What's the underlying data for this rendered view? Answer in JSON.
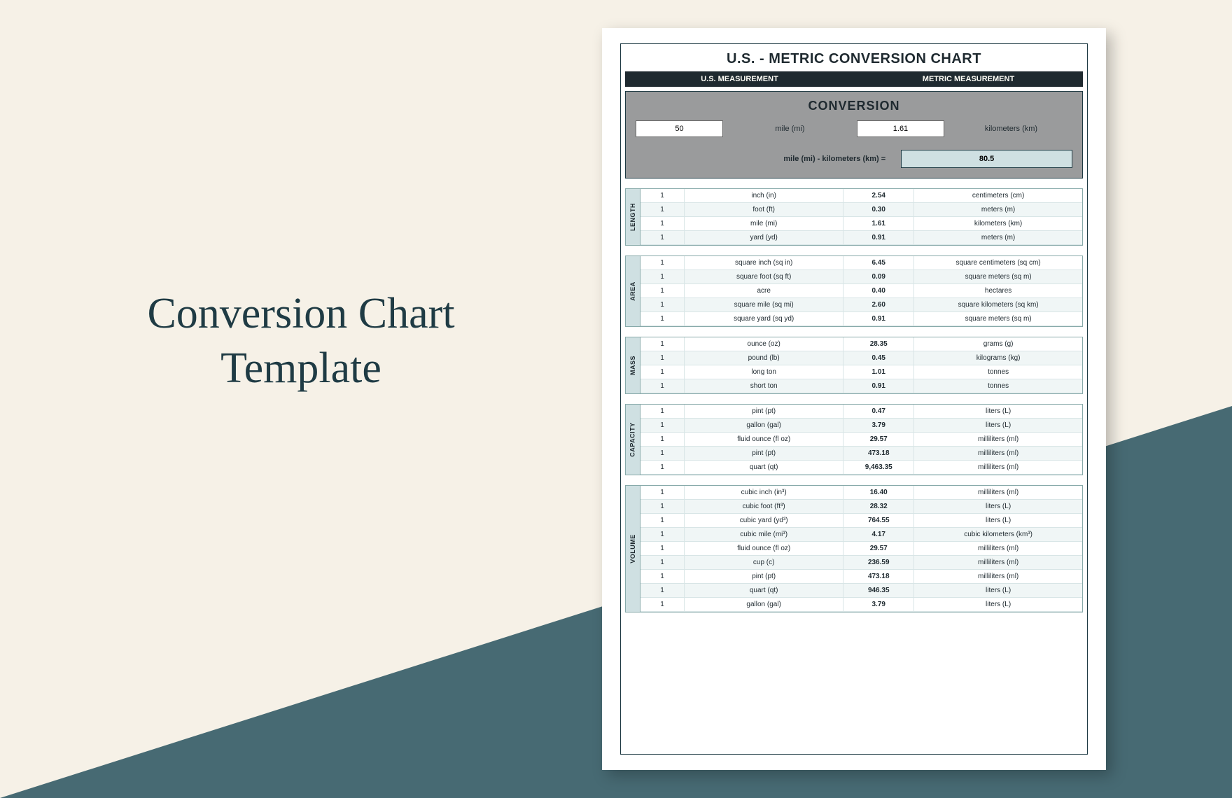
{
  "side_title": "Conversion Chart Template",
  "doc": {
    "title": "U.S. - METRIC CONVERSION CHART",
    "header_left": "U.S. MEASUREMENT",
    "header_right": "METRIC MEASUREMENT",
    "conversion": {
      "title": "CONVERSION",
      "input_value": "50",
      "input_unit": "mile (mi)",
      "factor": "1.61",
      "output_unit": "kilometers (km)",
      "result_label": "mile (mi) - kilometers (km) =",
      "result_value": "80.5"
    },
    "sections": [
      {
        "name": "LENGTH",
        "rows": [
          {
            "q": "1",
            "us": "inch (in)",
            "f": "2.54",
            "m": "centimeters (cm)"
          },
          {
            "q": "1",
            "us": "foot (ft)",
            "f": "0.30",
            "m": "meters (m)"
          },
          {
            "q": "1",
            "us": "mile (mi)",
            "f": "1.61",
            "m": "kilometers (km)"
          },
          {
            "q": "1",
            "us": "yard (yd)",
            "f": "0.91",
            "m": "meters (m)"
          }
        ]
      },
      {
        "name": "AREA",
        "rows": [
          {
            "q": "1",
            "us": "square inch (sq in)",
            "f": "6.45",
            "m": "square centimeters (sq cm)"
          },
          {
            "q": "1",
            "us": "square foot (sq ft)",
            "f": "0.09",
            "m": "square meters (sq m)"
          },
          {
            "q": "1",
            "us": "acre",
            "f": "0.40",
            "m": "hectares"
          },
          {
            "q": "1",
            "us": "square mile (sq mi)",
            "f": "2.60",
            "m": "square kilometers (sq km)"
          },
          {
            "q": "1",
            "us": "square yard (sq yd)",
            "f": "0.91",
            "m": "square meters (sq m)"
          }
        ]
      },
      {
        "name": "MASS",
        "rows": [
          {
            "q": "1",
            "us": "ounce (oz)",
            "f": "28.35",
            "m": "grams (g)"
          },
          {
            "q": "1",
            "us": "pound (lb)",
            "f": "0.45",
            "m": "kilograms (kg)"
          },
          {
            "q": "1",
            "us": "long ton",
            "f": "1.01",
            "m": "tonnes"
          },
          {
            "q": "1",
            "us": "short ton",
            "f": "0.91",
            "m": "tonnes"
          }
        ]
      },
      {
        "name": "CAPACITY",
        "rows": [
          {
            "q": "1",
            "us": "pint (pt)",
            "f": "0.47",
            "m": "liters (L)"
          },
          {
            "q": "1",
            "us": "gallon (gal)",
            "f": "3.79",
            "m": "liters (L)"
          },
          {
            "q": "1",
            "us": "fluid ounce (fl oz)",
            "f": "29.57",
            "m": "milliliters (ml)"
          },
          {
            "q": "1",
            "us": "pint (pt)",
            "f": "473.18",
            "m": "milliliters (ml)"
          },
          {
            "q": "1",
            "us": "quart (qt)",
            "f": "9,463.35",
            "m": "milliliters (ml)"
          }
        ]
      },
      {
        "name": "VOLUME",
        "rows": [
          {
            "q": "1",
            "us": "cubic inch (in³)",
            "f": "16.40",
            "m": "milliliters (ml)"
          },
          {
            "q": "1",
            "us": "cubic foot (ft³)",
            "f": "28.32",
            "m": "liters (L)"
          },
          {
            "q": "1",
            "us": "cubic yard (yd³)",
            "f": "764.55",
            "m": "liters (L)"
          },
          {
            "q": "1",
            "us": "cubic mile (mi³)",
            "f": "4.17",
            "m": "cubic kilometers (km³)"
          },
          {
            "q": "1",
            "us": "fluid ounce (fl oz)",
            "f": "29.57",
            "m": "milliliters (ml)"
          },
          {
            "q": "1",
            "us": "cup (c)",
            "f": "236.59",
            "m": "milliliters (ml)"
          },
          {
            "q": "1",
            "us": "pint (pt)",
            "f": "473.18",
            "m": "milliliters (ml)"
          },
          {
            "q": "1",
            "us": "quart (qt)",
            "f": "946.35",
            "m": "liters (L)"
          },
          {
            "q": "1",
            "us": "gallon (gal)",
            "f": "3.79",
            "m": "liters (L)"
          }
        ]
      }
    ]
  }
}
